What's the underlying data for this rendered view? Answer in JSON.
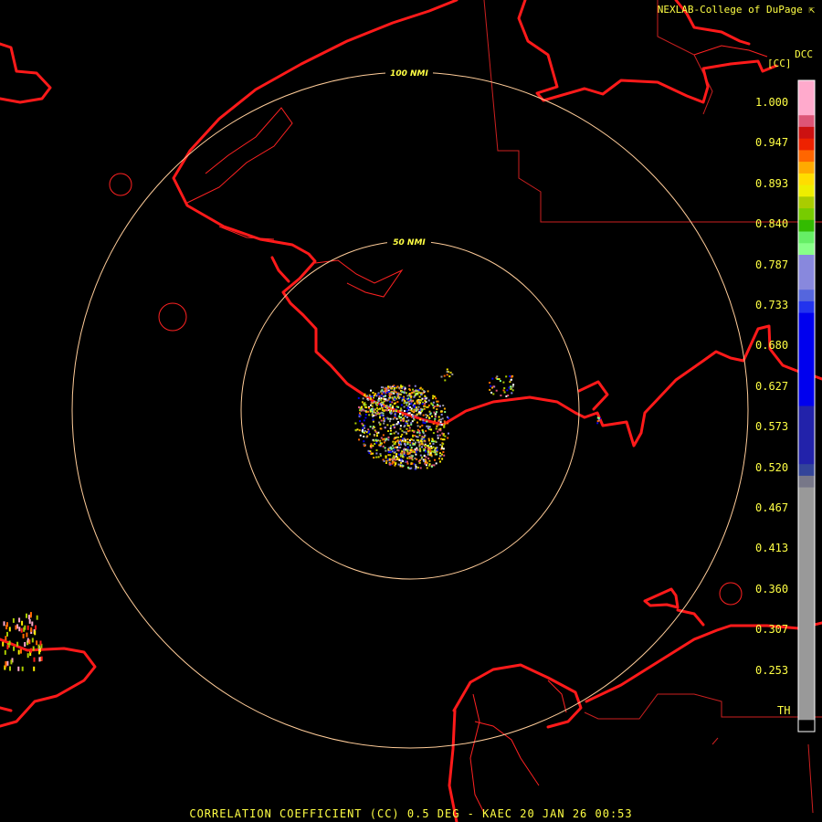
{
  "credit": "NEXLAB-College of DuPage",
  "credit_icon": "external-link-icon",
  "product_code": "DCC",
  "units": "[CC]",
  "footer": "CORRELATION COEFFICIENT (CC) 0.5 DEG - KAEC 20 JAN 26 00:53",
  "range_rings": [
    {
      "label": "50 NMI"
    },
    {
      "label": "100 NMI"
    }
  ],
  "colors": {
    "background": "#000000",
    "coastline": "#ff1a1a",
    "boundary": "#cc2020",
    "range_ring": "#ffcc99",
    "label_text": "#ffff44"
  },
  "color_scale": {
    "labels": [
      "1.000",
      "0.947",
      "0.893",
      "0.840",
      "0.787",
      "0.733",
      "0.680",
      "0.627",
      "0.573",
      "0.520",
      "0.467",
      "0.413",
      "0.360",
      "0.307",
      "0.253",
      "TH"
    ],
    "segments": [
      {
        "color": "#ffaacc",
        "weight": 3
      },
      {
        "color": "#dd5577",
        "weight": 1
      },
      {
        "color": "#cc1111",
        "weight": 1
      },
      {
        "color": "#ee2200",
        "weight": 1
      },
      {
        "color": "#ff6600",
        "weight": 1
      },
      {
        "color": "#ffaa00",
        "weight": 1
      },
      {
        "color": "#ffdd00",
        "weight": 1
      },
      {
        "color": "#eeee00",
        "weight": 1
      },
      {
        "color": "#aacc00",
        "weight": 1
      },
      {
        "color": "#77cc00",
        "weight": 1
      },
      {
        "color": "#33bb00",
        "weight": 1
      },
      {
        "color": "#66ee66",
        "weight": 1
      },
      {
        "color": "#88ff88",
        "weight": 1
      },
      {
        "color": "#8888dd",
        "weight": 3
      },
      {
        "color": "#5566dd",
        "weight": 1
      },
      {
        "color": "#2233ee",
        "weight": 1
      },
      {
        "color": "#0000ee",
        "weight": 8
      },
      {
        "color": "#2222aa",
        "weight": 5
      },
      {
        "color": "#334499",
        "weight": 1
      },
      {
        "color": "#777788",
        "weight": 1
      },
      {
        "color": "#999999",
        "weight": 20
      },
      {
        "color": "#000000",
        "weight": 1
      }
    ]
  }
}
